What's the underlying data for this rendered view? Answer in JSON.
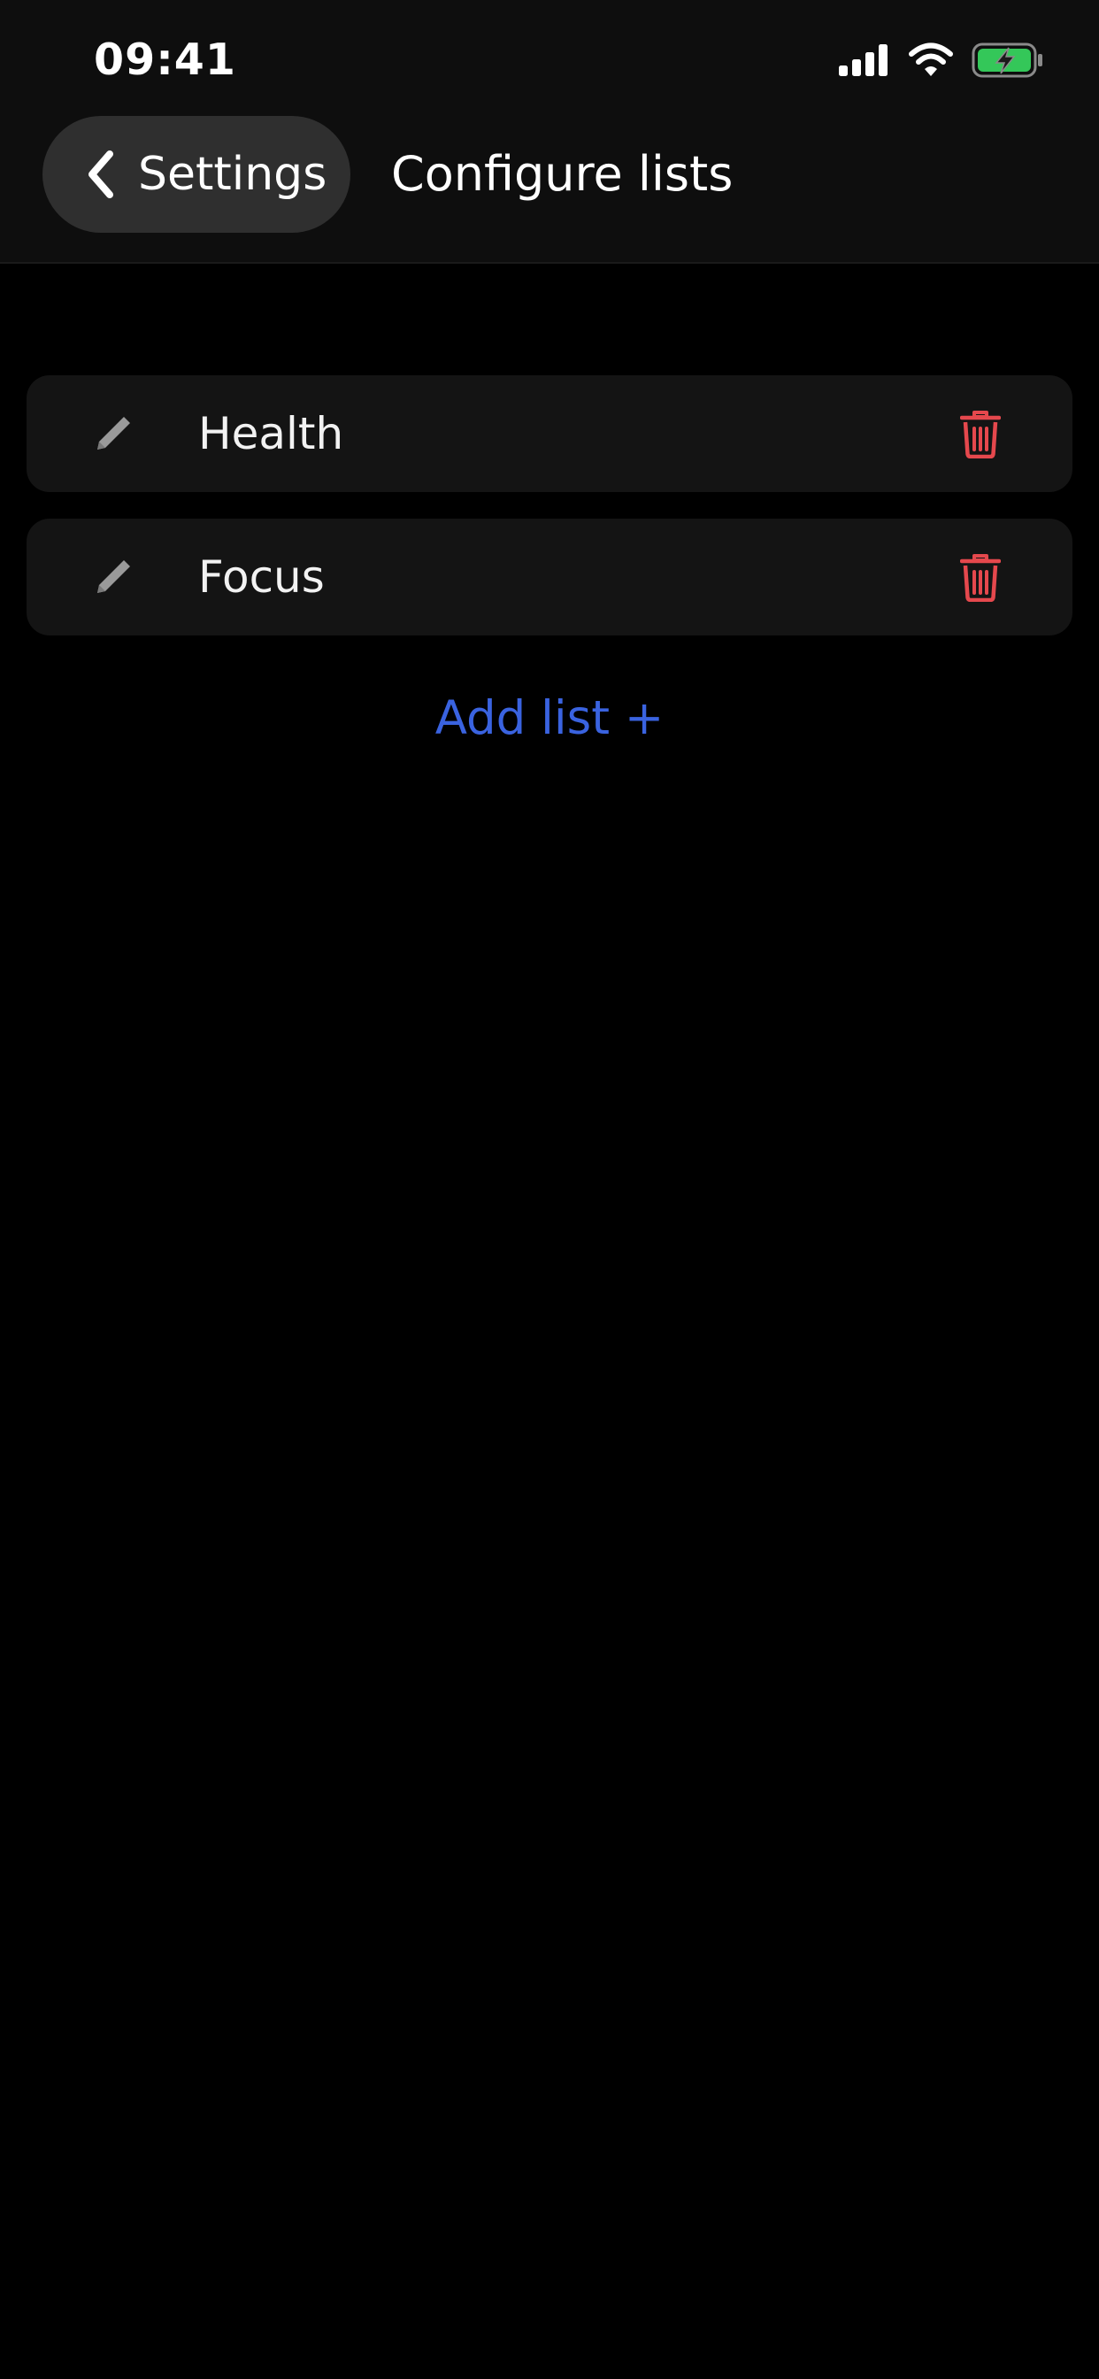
{
  "status_bar": {
    "time": "09:41",
    "icons": [
      "signal-icon",
      "wifi-icon",
      "battery-charging-icon"
    ],
    "battery_color": "#34c759"
  },
  "header": {
    "back_label": "Settings",
    "title": "Configure lists"
  },
  "lists": [
    {
      "label": "Health",
      "edit_icon": "pencil-icon",
      "delete_icon": "trash-icon"
    },
    {
      "label": "Focus",
      "edit_icon": "pencil-icon",
      "delete_icon": "trash-icon"
    }
  ],
  "add_list_label": "Add list +",
  "colors": {
    "accent": "#3a63e0",
    "delete": "#e5484d",
    "background": "#000000",
    "card": "#141414",
    "header": "#0e0e0e"
  }
}
